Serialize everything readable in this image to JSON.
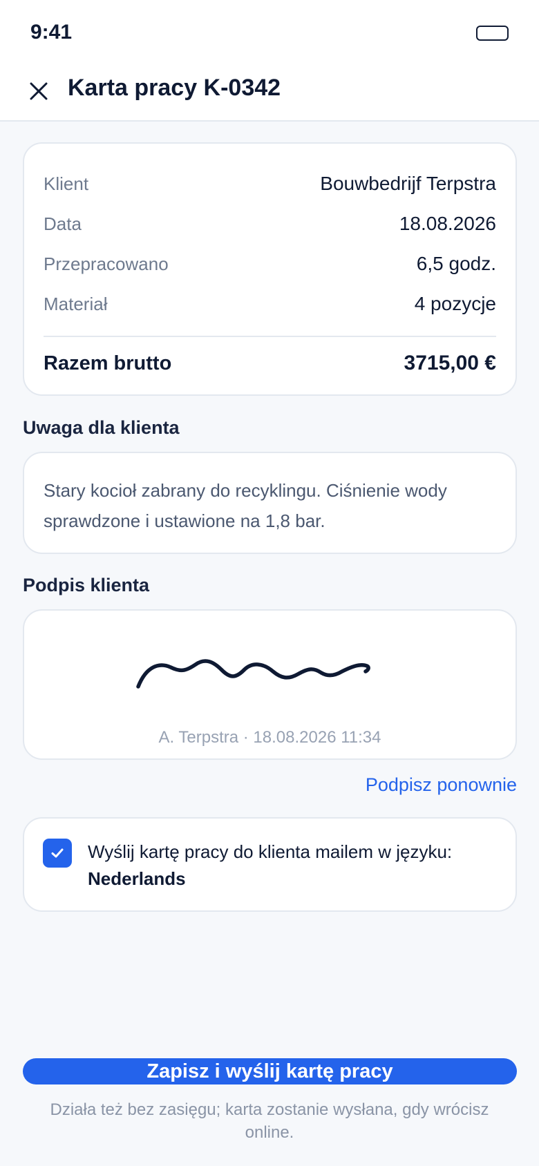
{
  "status_bar": {
    "time": "9:41",
    "icons": [
      "battery-icon"
    ]
  },
  "header": {
    "close_icon": "close-icon",
    "title": "Karta pracy K-0342"
  },
  "summary": {
    "rows": [
      {
        "label": "Klient",
        "value": "Bouwbedrijf Terpstra"
      },
      {
        "label": "Data",
        "value": "18.08.2026"
      },
      {
        "label": "Przepracowano",
        "value": "6,5 godz."
      },
      {
        "label": "Materiał",
        "value": "4 pozycje"
      }
    ],
    "total_label": "Razem brutto",
    "total_value": "3715,00 €"
  },
  "note": {
    "heading": "Uwaga dla klienta",
    "text": "Stary kocioł zabrany do recyklingu. Ciśnienie wody sprawdzone i ustawione na 1,8 bar."
  },
  "signature": {
    "heading": "Podpis klienta",
    "caption": "A. Terpstra · 18.08.2026 11:34",
    "resign_label": "Podpisz ponownie"
  },
  "email_option": {
    "checked": true,
    "text": "Wyślij kartę pracy do klienta mailem w języku:",
    "language": "Nederlands"
  },
  "actions": {
    "primary_label": "Zapisz i wyślij kartę pracy",
    "footnote": "Działa też bez zasięgu; karta zostanie wysłana, gdy wrócisz online."
  },
  "colors": {
    "accent": "#2463EB",
    "background": "#F6F8FB",
    "card": "#FFFFFF",
    "text_primary": "#0F1A33",
    "text_muted": "#6E7A8E"
  }
}
